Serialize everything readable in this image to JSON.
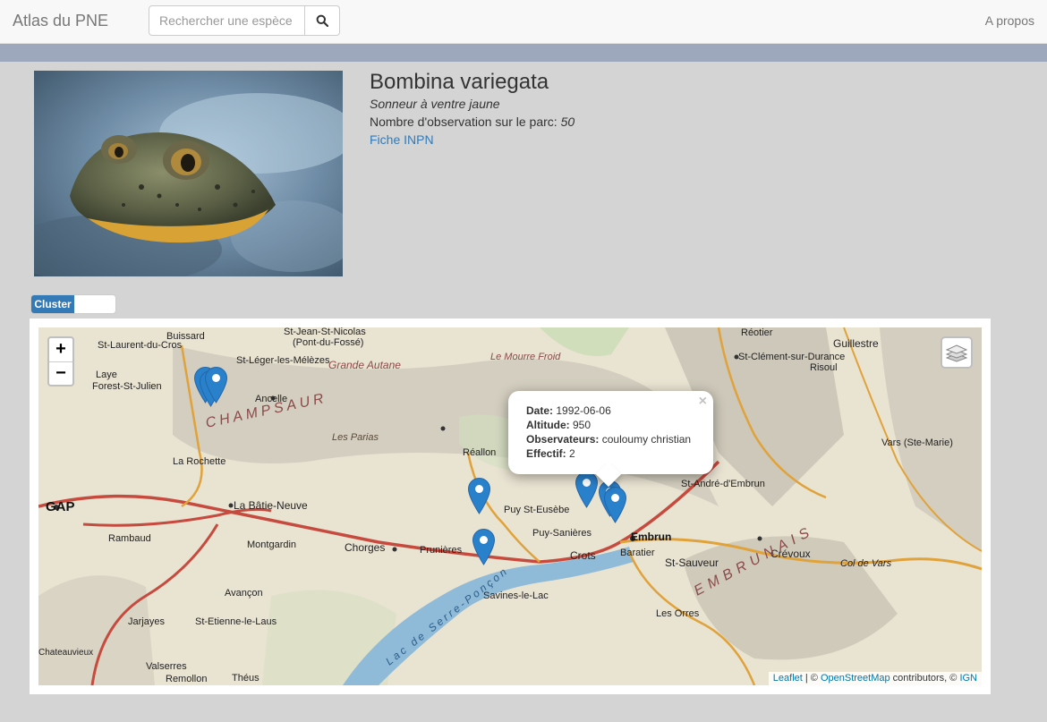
{
  "navbar": {
    "brand": "Atlas du PNE",
    "search_placeholder": "Rechercher une espèce",
    "about_link": "A propos"
  },
  "species": {
    "scientific_name": "Bombina variegata",
    "common_name": "Sonneur à ventre jaune",
    "observation_label": "Nombre d'observation sur le parc: ",
    "observation_count": "50",
    "inpn_link": "Fiche INPN"
  },
  "map": {
    "cluster_label": "Cluster",
    "zoom_in": "+",
    "zoom_out": "−",
    "popup": {
      "close": "×",
      "date_label": "Date:",
      "date": "1992-06-06",
      "altitude_label": "Altitude:",
      "altitude": "950",
      "observers_label": "Observateurs:",
      "observers": "couloumy christian",
      "effectif_label": "Effectif:",
      "effectif": "2"
    },
    "places": [
      "St-Jean-St-Nicolas",
      "(Pont-du-Fossé)",
      "St-Léger-les-Mélèzes",
      "Ancelle",
      "CHAMPSAUR",
      "Réallon",
      "Embrun",
      "St-André-d'Embrun",
      "GAP",
      "La Bâtie-Neuve",
      "Chorges",
      "Savines-le-Lac",
      "Crots",
      "St-Sauveur",
      "Les Orres",
      "Crévoux",
      "Vars (Ste-Marie)",
      "Guillestre",
      "Risoul",
      "Laye",
      "Forest-St-Julien",
      "La Rochette",
      "Rambaud",
      "Montgardin",
      "Avançon",
      "Jarjayes",
      "Valserres",
      "St-Etienne-le-Laus",
      "Théus",
      "Remollon",
      "Puy-Sanières",
      "Prunières",
      "Baratier",
      "Col de Vars",
      "EMBRUNAIS",
      "Lac de Serre-Ponçon",
      "Puy St-Eusèbe",
      "Buissard",
      "St-Laurent-du-Cros",
      "Les Parias",
      "Grande Autane",
      "Le Mourre Froid",
      "St-Clément-sur-Durance",
      "Réotier",
      "Chateauvieux"
    ],
    "attribution": {
      "leaflet": "Leaflet",
      "sep": " | © ",
      "osm": "OpenStreetMap",
      "contributors": " contributors, © ",
      "ign": "IGN"
    }
  },
  "colors": {
    "accent": "#337ab7",
    "band": "#9ea8bd",
    "marker": "#2a81cb"
  }
}
